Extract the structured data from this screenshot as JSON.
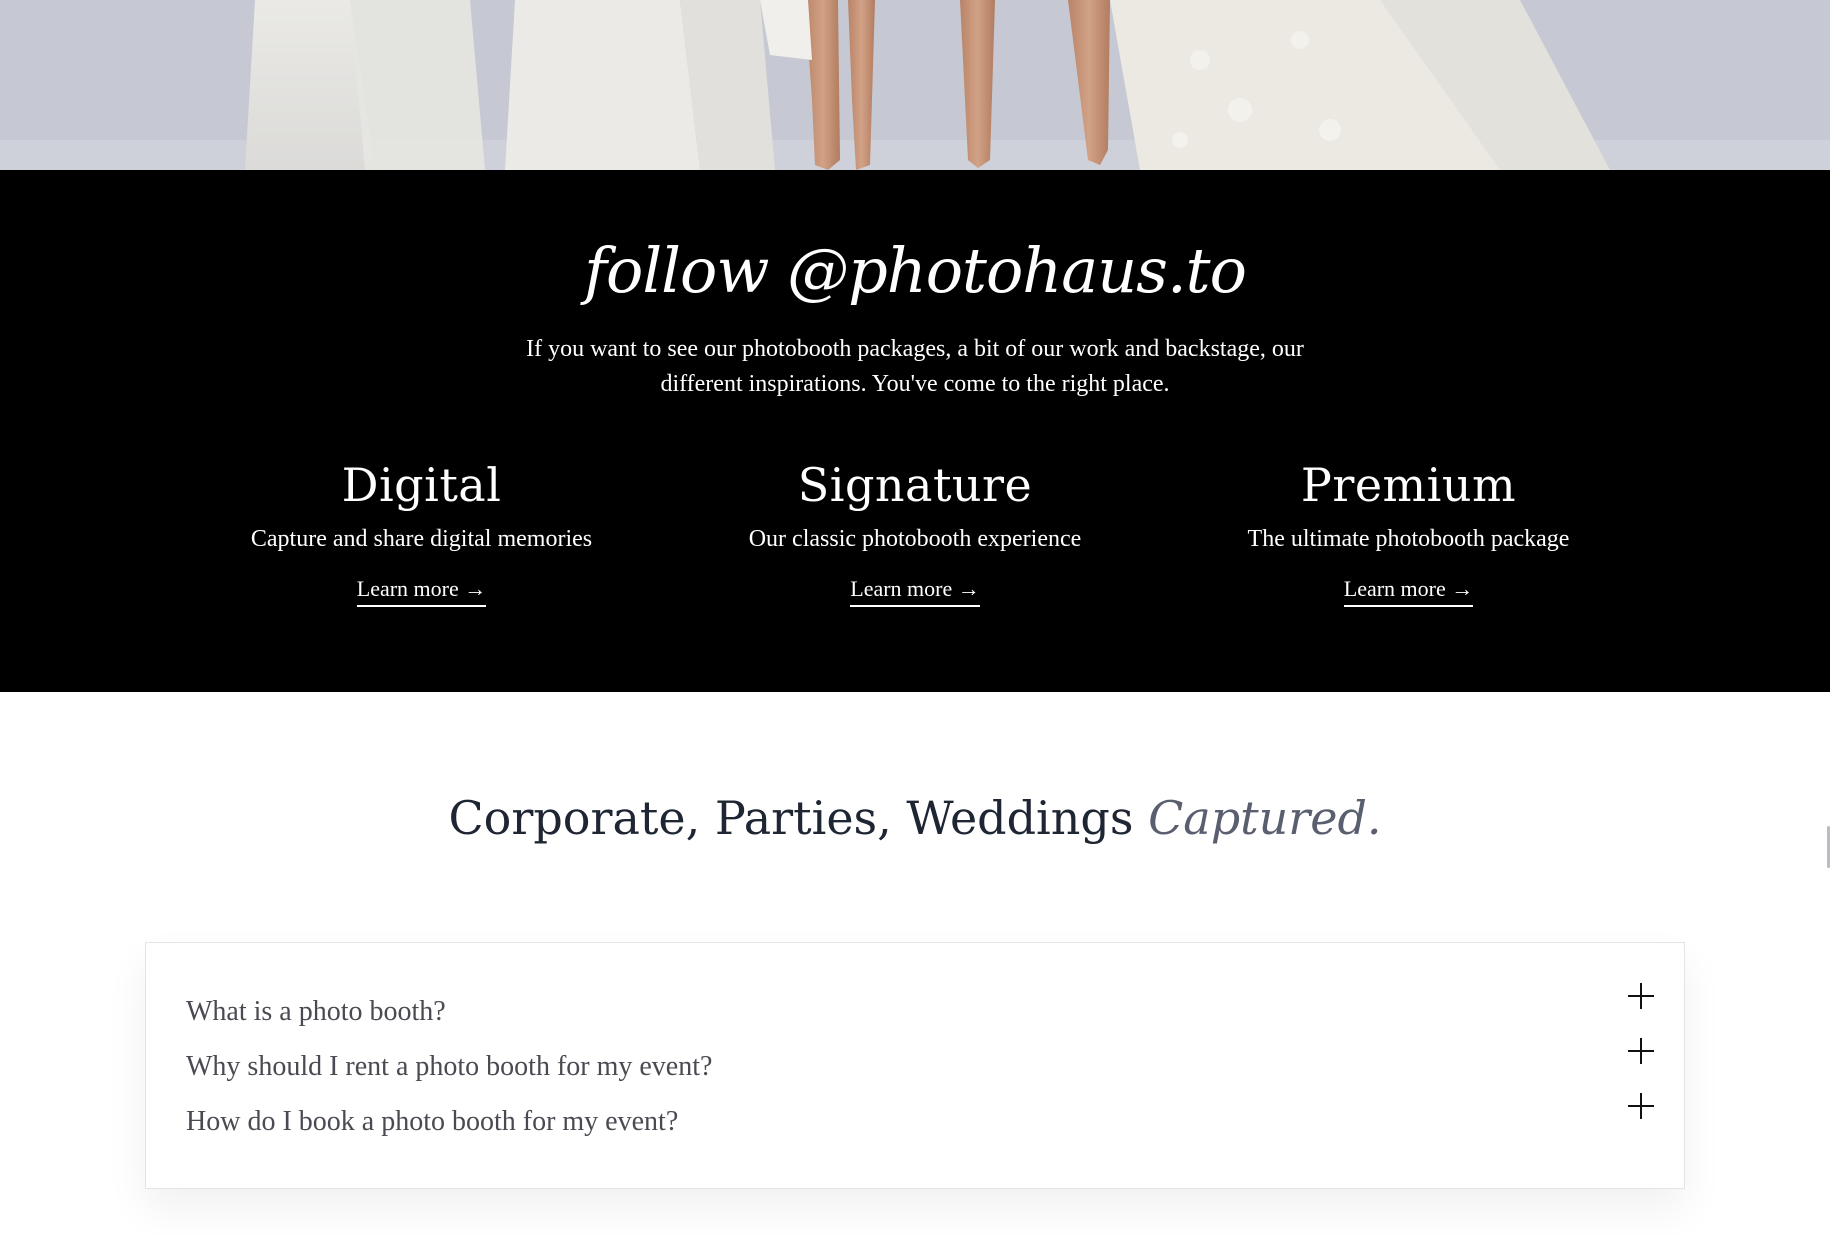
{
  "hero": {
    "image_description_icon": "photo-image",
    "background_color": "#c9ccd6"
  },
  "follow": {
    "title": "follow @photohaus.to",
    "description": "If you want to see our photobooth packages, a bit of our work and backstage, our different inspirations. You've come to the right place.",
    "background_color": "#000000",
    "packages": [
      {
        "name": "Digital",
        "subtitle": "Capture and share digital memories",
        "link_label": "Learn more →"
      },
      {
        "name": "Signature",
        "subtitle": "Our classic photobooth experience",
        "link_label": "Learn more →"
      },
      {
        "name": "Premium",
        "subtitle": "The ultimate photobooth package",
        "link_label": "Learn more →"
      }
    ]
  },
  "tagline": {
    "main": "Corporate, Parties, Weddings ",
    "accent": "Captured.",
    "text_color": "#1e2533",
    "accent_color": "#5a5f70"
  },
  "faq": {
    "items": [
      {
        "question": "What is a photo booth?",
        "icon": "plus-icon"
      },
      {
        "question": "Why should I rent a photo booth for my event?",
        "icon": "plus-icon"
      },
      {
        "question": "How do I book a photo booth for my event?",
        "icon": "plus-icon"
      }
    ]
  }
}
